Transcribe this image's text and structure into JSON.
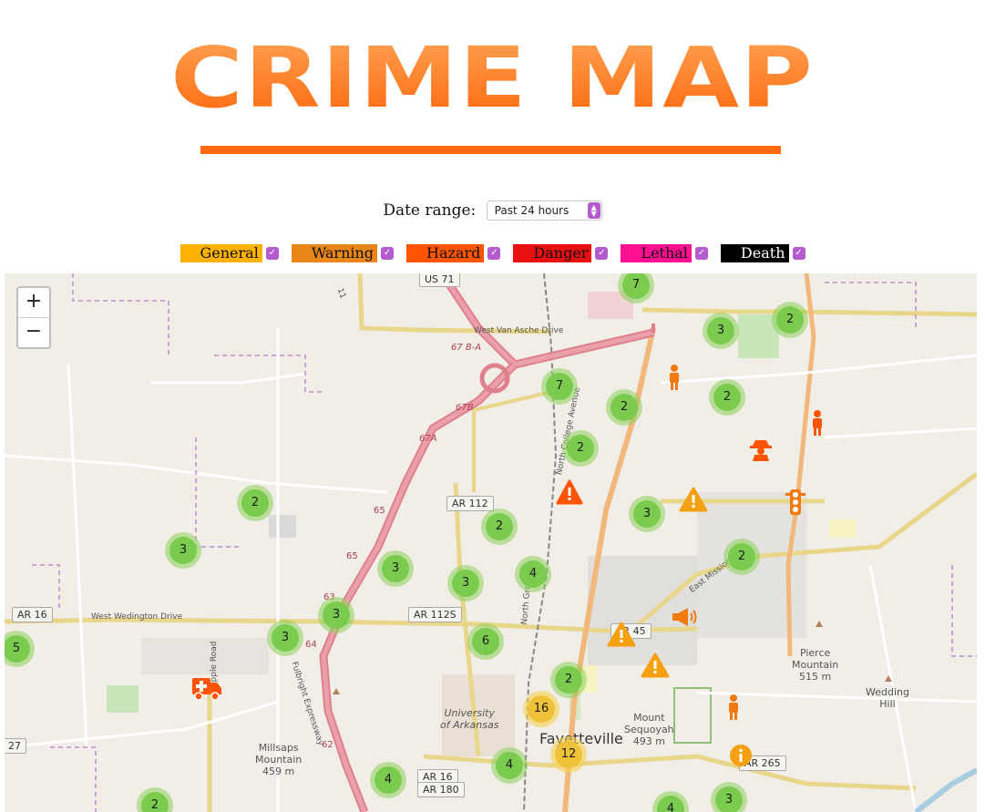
{
  "title": "CRIME MAP",
  "date_range": {
    "label": "Date range:",
    "selected": "Past 24 hours"
  },
  "legend": [
    {
      "label": "General",
      "color": "#ffb300",
      "checked": true
    },
    {
      "label": "Warning",
      "color": "#e8861a",
      "checked": true
    },
    {
      "label": "Hazard",
      "color": "#ff5500",
      "checked": true
    },
    {
      "label": "Danger",
      "color": "#e81010",
      "checked": true
    },
    {
      "label": "Lethal",
      "color": "#ff1090",
      "checked": true
    },
    {
      "label": "Death",
      "color": "#000000",
      "text_color": "#ffffff",
      "checked": true
    }
  ],
  "zoom": {
    "in": "+",
    "out": "−"
  },
  "map_labels": {
    "us71": "US 71",
    "west_van_asche": "West Van Asche Drive",
    "ramp_67ba": "67 B-A",
    "ramp_67b": "67B",
    "ramp_67a": "67A",
    "ar112": "AR 112",
    "ar16": "AR 16",
    "west_wedington": "West Wedington Drive",
    "ar112s": "AR 112S",
    "ar45": "AR 45",
    "north_college": "North College Avenue",
    "north_gregg": "North Gregg",
    "east_mission": "East Mission",
    "rupple": "Rupple Road",
    "fulbright": "Fulbright Expressway",
    "exit65": "65",
    "exit64": "64",
    "exit62": "62",
    "exit63": "63",
    "university": "University\nof Arkansas",
    "fayetteville": "Fayetteville",
    "mount_sequoyah": "Mount\nSequoyah\n493 m",
    "pierce": "Pierce\nMountain\n515 m",
    "wedding": "Wedding\nHill",
    "millsaps": "Millsaps\nMountain\n459 m",
    "ar16_bottom": "AR 16",
    "ar180": "AR 180",
    "ar265": "AR 265",
    "n27": "27",
    "road_11": "11"
  },
  "clusters": [
    {
      "count": "7"
    },
    {
      "count": "3"
    },
    {
      "count": "2"
    },
    {
      "count": "7"
    },
    {
      "count": "2"
    },
    {
      "count": "2"
    },
    {
      "count": "2"
    },
    {
      "count": "2"
    },
    {
      "count": "3"
    },
    {
      "count": "3"
    },
    {
      "count": "2"
    },
    {
      "count": "3"
    },
    {
      "count": "3"
    },
    {
      "count": "4"
    },
    {
      "count": "2"
    },
    {
      "count": "3"
    },
    {
      "count": "3"
    },
    {
      "count": "6"
    },
    {
      "count": "5"
    },
    {
      "count": "2"
    },
    {
      "count": "16",
      "size": "medium"
    },
    {
      "count": "12",
      "size": "medium"
    },
    {
      "count": "4"
    },
    {
      "count": "4"
    },
    {
      "count": "2"
    },
    {
      "count": "4"
    },
    {
      "count": "3"
    }
  ],
  "markers": [
    {
      "icon": "person-icon",
      "color": "#f07a10"
    },
    {
      "icon": "person-icon",
      "color": "#ff5500"
    },
    {
      "icon": "detective-icon",
      "color": "#ff5500"
    },
    {
      "icon": "hazard-sign-icon",
      "color": "#ff5500"
    },
    {
      "icon": "warning-triangle-icon",
      "color": "#f5a010"
    },
    {
      "icon": "traffic-light-icon",
      "color": "#f07a10"
    },
    {
      "icon": "megaphone-icon",
      "color": "#f07a10"
    },
    {
      "icon": "warning-triangle-icon",
      "color": "#f5a010"
    },
    {
      "icon": "warning-triangle-icon",
      "color": "#f5a010"
    },
    {
      "icon": "ambulance-icon",
      "color": "#ff5500"
    },
    {
      "icon": "person-icon",
      "color": "#f07a10"
    },
    {
      "icon": "info-icon",
      "color": "#f5a010"
    }
  ]
}
